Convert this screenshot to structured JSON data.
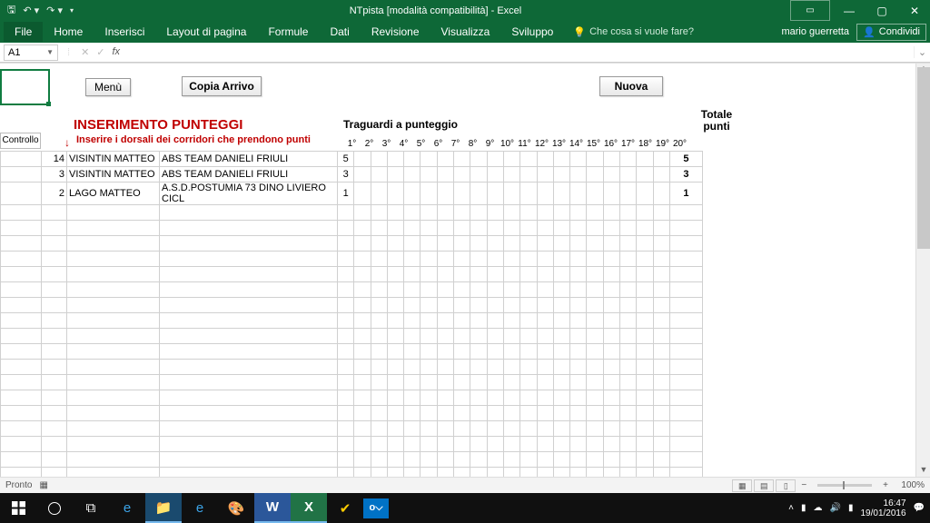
{
  "title_bar": {
    "title": "NTpista  [modalità compatibilità] - Excel"
  },
  "ribbon": {
    "tabs": {
      "file": "File",
      "home": "Home",
      "inserisci": "Inserisci",
      "layout": "Layout di pagina",
      "formule": "Formule",
      "dati": "Dati",
      "revisione": "Revisione",
      "visualizza": "Visualizza",
      "sviluppo": "Sviluppo"
    },
    "tell_me": "Che cosa si vuole fare?",
    "user": "mario guerretta",
    "share": "Condividi"
  },
  "fbar": {
    "cell": "A1"
  },
  "sheet": {
    "btn_menu": "Menù",
    "btn_copia": "Copia Arrivo",
    "btn_nuova": "Nuova",
    "h_ins": "INSERIMENTO PUNTEGGI",
    "h_trag": "Traguardi a punteggio",
    "h_tot": "Totale punti",
    "h_red2": "Inserire i dorsali dei corridori che prendono punti",
    "h_ctrl": "Controllo",
    "degrees": [
      "1°",
      "2°",
      "3°",
      "4°",
      "5°",
      "6°",
      "7°",
      "8°",
      "9°",
      "10°",
      "11°",
      "12°",
      "13°",
      "14°",
      "15°",
      "16°",
      "17°",
      "18°",
      "19°",
      "20°"
    ],
    "rows": [
      {
        "dorsal": "14",
        "nome": "VISINTIN MATTEO",
        "team": "ABS TEAM DANIELI FRIULI",
        "p1": "5",
        "tot": "5"
      },
      {
        "dorsal": "3",
        "nome": "VISINTIN MATTEO",
        "team": "ABS TEAM DANIELI FRIULI",
        "p1": "3",
        "tot": "3"
      },
      {
        "dorsal": "2",
        "nome": "LAGO MATTEO",
        "team": "A.S.D.POSTUMIA 73 DINO LIVIERO CICL",
        "p1": "1",
        "tot": "1"
      }
    ]
  },
  "status": {
    "left": "Pronto",
    "zoom": "100%"
  },
  "tray": {
    "time": "16:47",
    "date": "19/01/2016"
  }
}
